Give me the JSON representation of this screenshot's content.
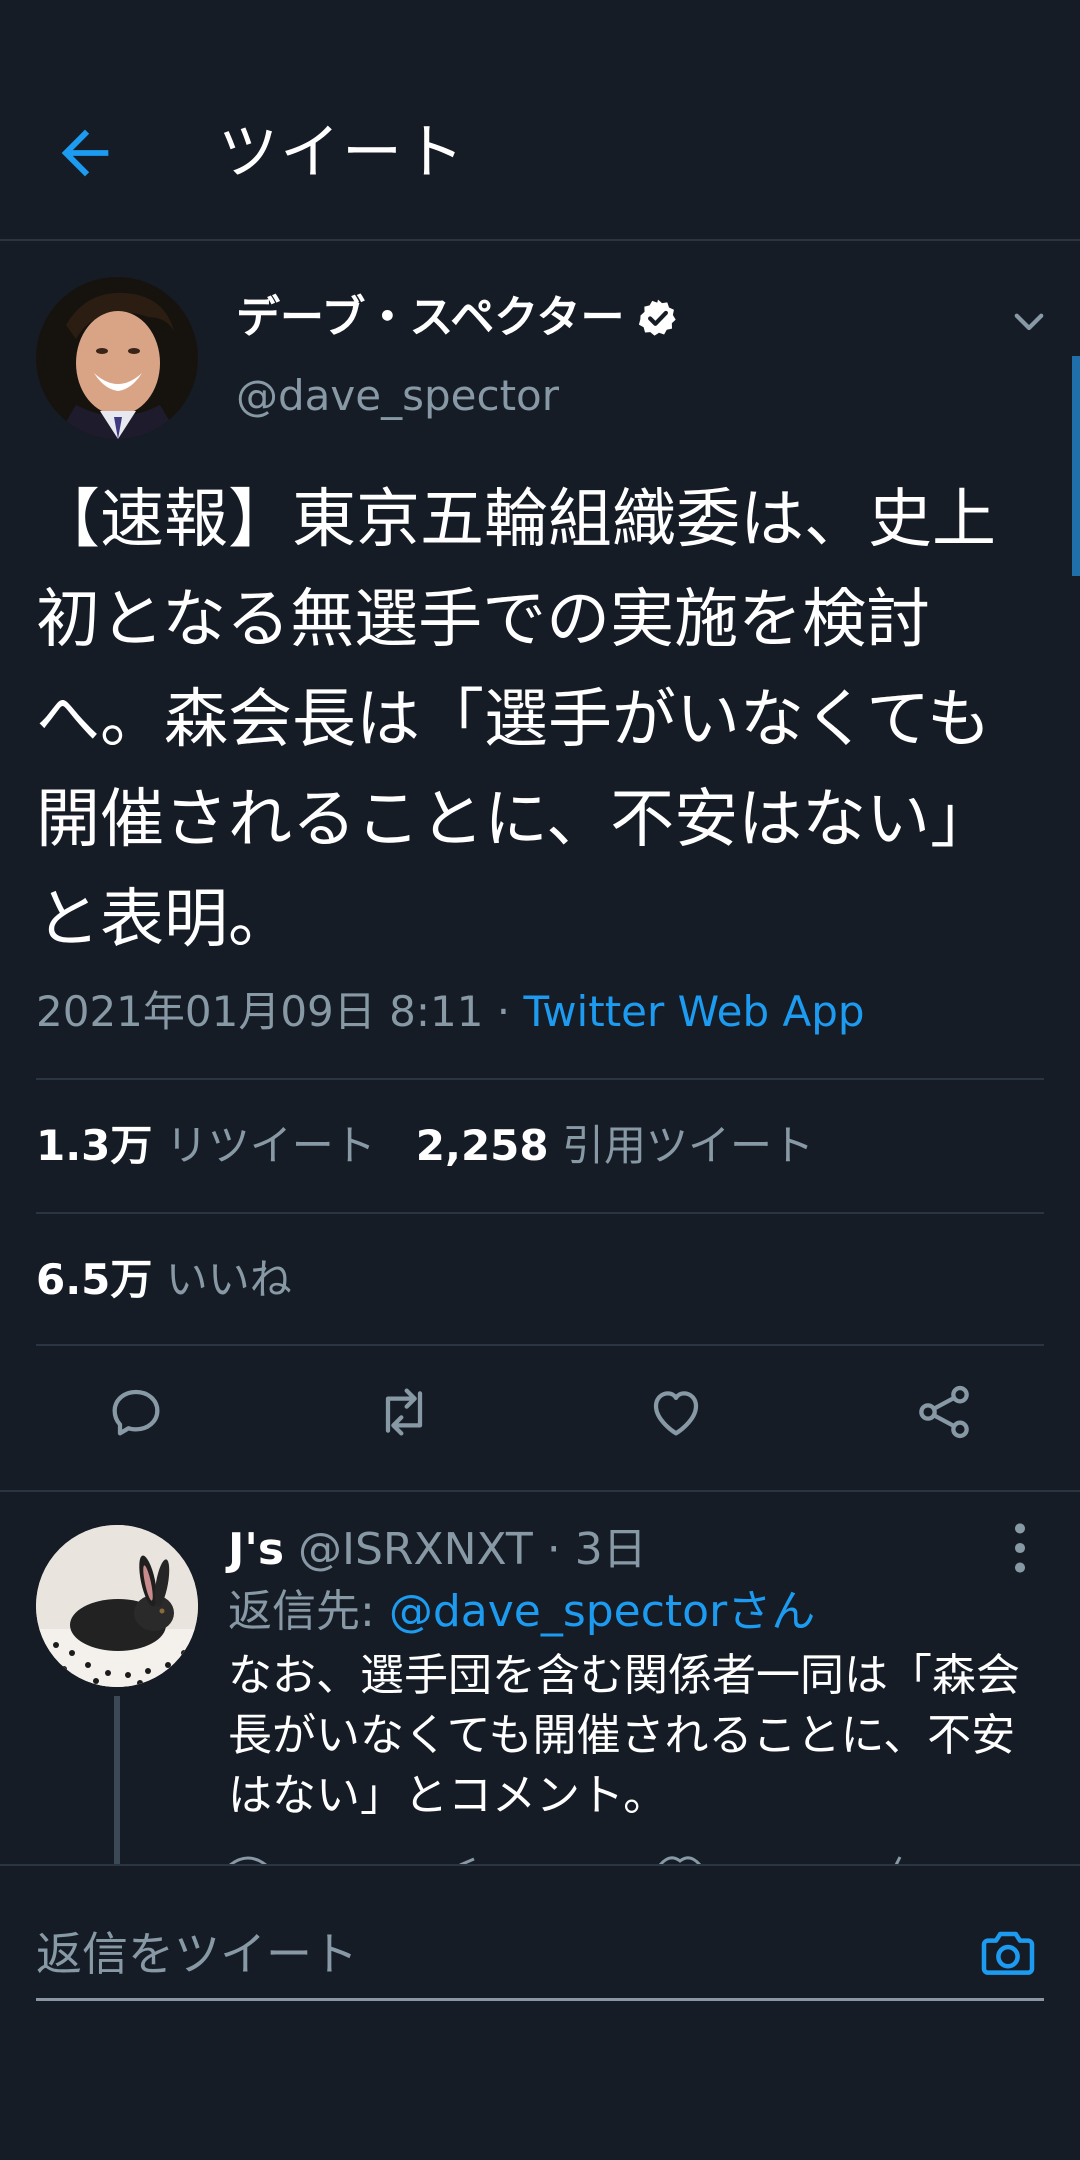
{
  "header": {
    "title": "ツイート"
  },
  "tweet": {
    "author_name": "デーブ・スペクター",
    "author_handle": "@dave_spector",
    "text": "【速報】東京五輪組織委は、史上初となる無選手での実施を検討へ。森会長は「選手がいなくても開催されることに、不安はない」と表明。",
    "timestamp": "2021年01月09日 8:11 · ",
    "source": "Twitter Web App",
    "retweets_count": "1.3万",
    "retweets_label": "リツイート",
    "quotes_count": "2,258",
    "quotes_label": "引用ツイート",
    "likes_count": "6.5万",
    "likes_label": "いいね"
  },
  "reply": {
    "name": "J's",
    "handle_time": " @ISRXNXT · 3日",
    "replying_label": "返信先: ",
    "replying_to": "@dave_spectorさん",
    "text": "なお、選手団を含む関係者一同は「森会長がいなくても開催されることに、不安はない」とコメント。"
  },
  "compose": {
    "placeholder": "返信をツイート"
  },
  "colors": {
    "background": "#151c26",
    "accent": "#1d9bf0",
    "secondary_text": "#8899a6",
    "divider": "#2b3542"
  },
  "icons": {
    "back": "arrow-left-icon",
    "verified": "verified-badge-icon",
    "caret": "chevron-down-icon",
    "reply": "reply-icon",
    "retweet": "retweet-icon",
    "like": "heart-icon",
    "share": "share-icon",
    "more": "more-vertical-icon",
    "camera": "camera-icon"
  }
}
